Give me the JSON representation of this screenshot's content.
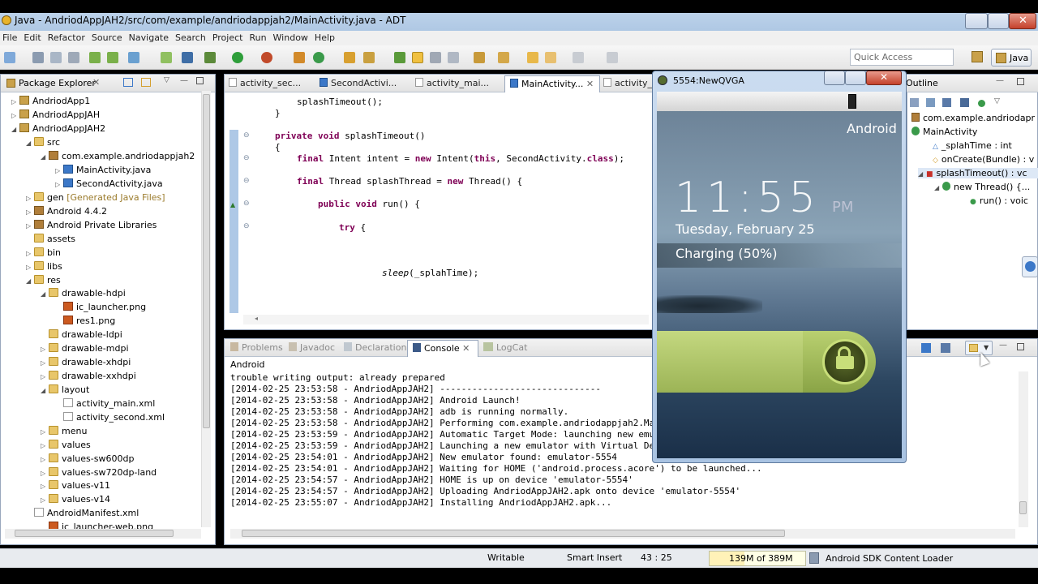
{
  "window": {
    "title": "Java - AndriodAppJAH2/src/com/example/andriodappjah2/MainActivity.java - ADT"
  },
  "menu": [
    "File",
    "Edit",
    "Refactor",
    "Source",
    "Navigate",
    "Search",
    "Project",
    "Run",
    "Window",
    "Help"
  ],
  "quick_access": {
    "placeholder": "Quick Access"
  },
  "perspective": {
    "label": "Java"
  },
  "package_explorer": {
    "title": "Package Explorer",
    "items": [
      {
        "label": "AndriodApp1"
      },
      {
        "label": "AndriodAppJAH"
      },
      {
        "label": "AndriodAppJAH2"
      },
      {
        "label": "src"
      },
      {
        "label": "com.example.andriodappjah2"
      },
      {
        "label": "MainActivity.java"
      },
      {
        "label": "SecondActivity.java"
      },
      {
        "label": "gen",
        "suffix": "[Generated Java Files]"
      },
      {
        "label": "Android 4.4.2"
      },
      {
        "label": "Android Private Libraries"
      },
      {
        "label": "assets"
      },
      {
        "label": "bin"
      },
      {
        "label": "libs"
      },
      {
        "label": "res"
      },
      {
        "label": "drawable-hdpi"
      },
      {
        "label": "ic_launcher.png"
      },
      {
        "label": "res1.png"
      },
      {
        "label": "drawable-ldpi"
      },
      {
        "label": "drawable-mdpi"
      },
      {
        "label": "drawable-xhdpi"
      },
      {
        "label": "drawable-xxhdpi"
      },
      {
        "label": "layout"
      },
      {
        "label": "activity_main.xml"
      },
      {
        "label": "activity_second.xml"
      },
      {
        "label": "menu"
      },
      {
        "label": "values"
      },
      {
        "label": "values-sw600dp"
      },
      {
        "label": "values-sw720dp-land"
      },
      {
        "label": "values-v11"
      },
      {
        "label": "values-v14"
      },
      {
        "label": "AndroidManifest.xml"
      },
      {
        "label": "ic_launcher-web.png"
      }
    ]
  },
  "editor_tabs": [
    "activity_sec...",
    "SecondActivi...",
    "activity_mai...",
    "MainActivity...",
    "activity_"
  ],
  "code": {
    "l1": "splashTimeout();",
    "l2": "}",
    "l3a": "private void",
    "l3b": " splashTimeout()",
    "l4": "{",
    "l5a": "final",
    "l5b": " Intent intent = ",
    "l5c": "new",
    "l5d": " Intent(",
    "l5e": "this",
    "l5f": ", SecondActivity.",
    "l5g": "class",
    "l5h": ");",
    "l6a": "final",
    "l6b": " Thread splashThread = ",
    "l6c": "new",
    "l6d": " Thread() {",
    "l7a": "public void",
    "l7b": " run() {",
    "l8": "try",
    "l8b": " {",
    "l9a": "sleep",
    "l9b": "(_splahTime);"
  },
  "outline": {
    "title": "Outline",
    "items": [
      "com.example.andriodapr",
      "MainActivity",
      "_splahTime : int",
      "onCreate(Bundle) : v",
      "splashTimeout() : vc",
      "new Thread() {...",
      "run() : voic"
    ]
  },
  "bottom_tabs": [
    "Problems",
    "Javadoc",
    "Declaration",
    "Console",
    "LogCat"
  ],
  "console": {
    "header": "Android",
    "lines": [
      "trouble writing output: already prepared",
      "[2014-02-25 23:53:58 - AndriodAppJAH2] ------------------------------",
      "[2014-02-25 23:53:58 - AndriodAppJAH2] Android Launch!",
      "[2014-02-25 23:53:58 - AndriodAppJAH2] adb is running normally.",
      "[2014-02-25 23:53:58 - AndriodAppJAH2] Performing com.example.andriodappjah2.Ma",
      "[2014-02-25 23:53:59 - AndriodAppJAH2] Automatic Target Mode: launching new emu",
      "[2014-02-25 23:53:59 - AndriodAppJAH2] Launching a new emulator with Virtual De",
      "[2014-02-25 23:54:01 - AndriodAppJAH2] New emulator found: emulator-5554",
      "[2014-02-25 23:54:01 - AndriodAppJAH2] Waiting for HOME ('android.process.acore') to be launched...",
      "[2014-02-25 23:54:57 - AndriodAppJAH2] HOME is up on device 'emulator-5554'",
      "[2014-02-25 23:54:57 - AndriodAppJAH2] Uploading AndriodAppJAH2.apk onto device 'emulator-5554'",
      "[2014-02-25 23:55:07 - AndriodAppJAH2] Installing AndriodAppJAH2.apk..."
    ]
  },
  "emulator": {
    "title": "5554:NewQVGA",
    "carrier": "Android",
    "time": "11:55",
    "ampm": "PM",
    "date": "Tuesday, February 25",
    "charging": "Charging (50%)"
  },
  "statusbar": {
    "mode": "Writable",
    "insert": "Smart Insert",
    "position": "43 : 25",
    "heap": "139M of 389M",
    "task": "Android SDK Content Loader"
  },
  "colors": {
    "accent": "#3c78c8",
    "emulator_slider": "#a8c25a"
  }
}
